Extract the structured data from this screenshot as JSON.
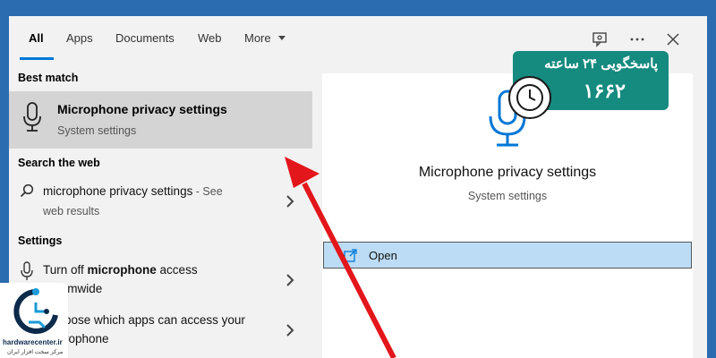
{
  "tabs": [
    {
      "label": "All"
    },
    {
      "label": "Apps"
    },
    {
      "label": "Documents"
    },
    {
      "label": "Web"
    },
    {
      "label": "More"
    }
  ],
  "header_icons": [
    "feedback-icon",
    "more-options-icon",
    "close-icon"
  ],
  "best_match": {
    "heading": "Best match",
    "title": "Microphone privacy settings",
    "subtitle": "System settings",
    "icon": "microphone-icon"
  },
  "search_web": {
    "heading": "Search the web",
    "query": "microphone privacy settings",
    "suffix": " - See",
    "line2": "web results",
    "icon": "search-icon"
  },
  "settings": {
    "heading": "Settings",
    "items": [
      {
        "pre": "Turn off ",
        "bold": "microphone",
        "post": " access",
        "line2": "temwide",
        "icon": "microphone-icon"
      },
      {
        "pre": "oose which apps can access your",
        "line2": "rophone",
        "icon": "shield-icon"
      }
    ]
  },
  "preview": {
    "title": "Microphone privacy settings",
    "subtitle": "System settings",
    "open_label": "Open",
    "icon": "microphone-icon"
  },
  "badge": {
    "line1": "پاسخگویی ۲۴ ساعته",
    "line2": "۱۶۶۲"
  },
  "logo": {
    "name": "hardwarecenter.ir",
    "subtitle": "مرکز سخت افزار ایران"
  },
  "colors": {
    "accent": "#0078d7",
    "selected_row": "#d4d4d4",
    "open_button": "#bcdcf5",
    "badge": "#158a7f",
    "arrow": "#e3161b"
  }
}
